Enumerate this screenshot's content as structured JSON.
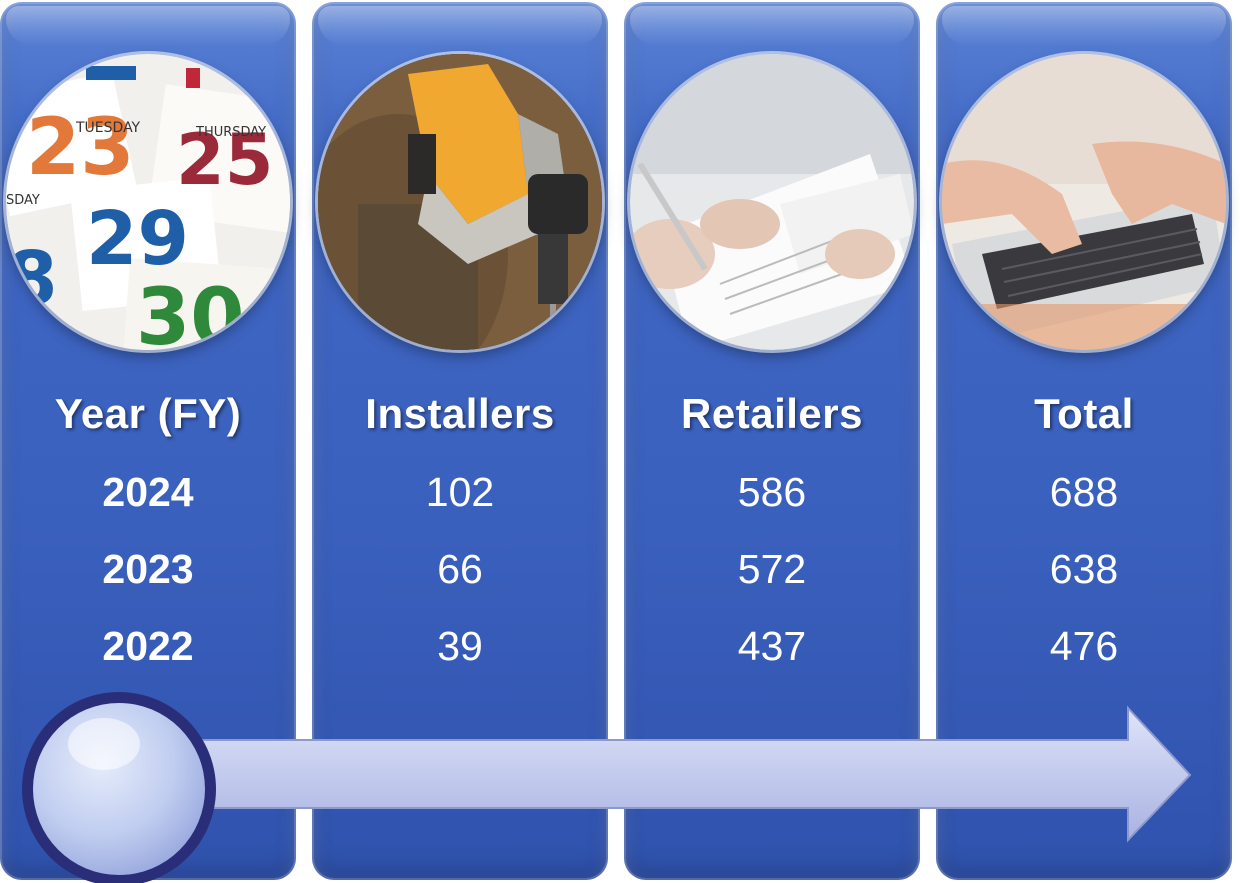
{
  "columns": [
    {
      "header": "Year (FY)",
      "image": "calendar-pages",
      "values": [
        "2024",
        "2023",
        "2022"
      ]
    },
    {
      "header": "Installers",
      "image": "worker-with-drill",
      "values": [
        "102",
        "66",
        "39"
      ]
    },
    {
      "header": "Retailers",
      "image": "signing-documents",
      "values": [
        "586",
        "572",
        "437"
      ]
    },
    {
      "header": "Total",
      "image": "typing-on-laptop",
      "values": [
        "688",
        "638",
        "476"
      ]
    }
  ],
  "colors": {
    "panel": "#3a60bd",
    "arrow": "#c5cdf0",
    "knob": "#c3d1f3",
    "knob_ring": "#2a2e78",
    "text": "#ffffff"
  }
}
